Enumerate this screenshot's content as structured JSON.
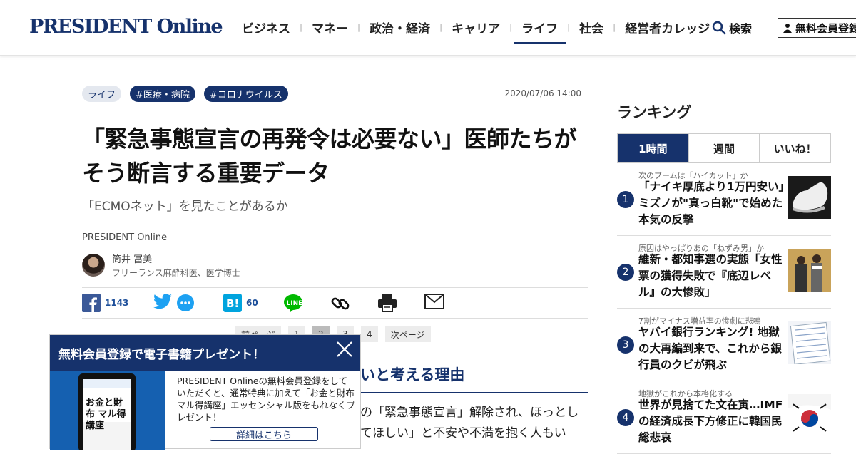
{
  "header": {
    "logo": "PRESIDENT Online",
    "nav": [
      "ビジネス",
      "マネー",
      "政治・経済",
      "キャリア",
      "ライフ",
      "社会",
      "経営者カレッジ"
    ],
    "search_label": "検索",
    "signup_label": "無料会員登録"
  },
  "article": {
    "tags": [
      "ライフ",
      "#医療・病院",
      "#コロナウイルス"
    ],
    "date": "2020/07/06 14:00",
    "title_line1": "「緊急事態宣言の再発令は必要ない」医師たちが",
    "title_line2": "そう断言する重要データ",
    "subtitle": "「ECMOネット」を見たことがあるか",
    "source": "PRESIDENT Online",
    "author_name": "筒井 冨美",
    "author_role": "フリーランス麻酔科医、医学博士",
    "share": {
      "facebook_count": "1143",
      "hatena_count": "60"
    },
    "pager": {
      "prev": "前ページ",
      "pages": [
        "1",
        "2",
        "3",
        "4"
      ],
      "current": "2",
      "next": "次ページ"
    },
    "section_head": "いと考える理由",
    "body_line1": "の「緊急事態宣言」解除され、ほっとし",
    "body_line2": "てほしい」と不安や不満を抱く人もい"
  },
  "sidebar": {
    "title": "ランキング",
    "tabs": [
      "1時間",
      "週間",
      "いいね！"
    ],
    "items": [
      {
        "num": "1",
        "kicker": "次のブームは「ハイカット」か",
        "title": "「ナイキ厚底より1万円安い」ミズノが\"真っ白靴\"で始めた本気の反撃"
      },
      {
        "num": "2",
        "kicker": "原因はやっぱりあの「ねずみ男」か",
        "title": "維新・都知事選の実態「女性票の獲得失敗で『底辺レベル』の大惨敗」"
      },
      {
        "num": "3",
        "kicker": "7割がマイナス増益率の惨劇に悲鳴",
        "title": "ヤバイ銀行ランキング! 地獄の大再編到来で、これから銀行員のクビが飛ぶ"
      },
      {
        "num": "4",
        "kicker": "地獄がこれから本格化する",
        "title": "世界が見捨てた文在寅…IMFの経済成長下方修正に韓国民総悲哀"
      }
    ]
  },
  "popup": {
    "title": "無料会員登録で電子書籍プレゼント！",
    "text": "PRESIDENT Onlineの無料会員登録をしていただくと、通常特典に加えて「お金と財布マル得講座」エッセンシャル版をもれなくプレゼント！",
    "button": "詳細はこちら",
    "book_title": "お金と財布 マル得講座"
  },
  "colors": {
    "brand": "#16326c",
    "facebook": "#3b5998",
    "twitter": "#1da1f2",
    "line": "#00b900"
  }
}
